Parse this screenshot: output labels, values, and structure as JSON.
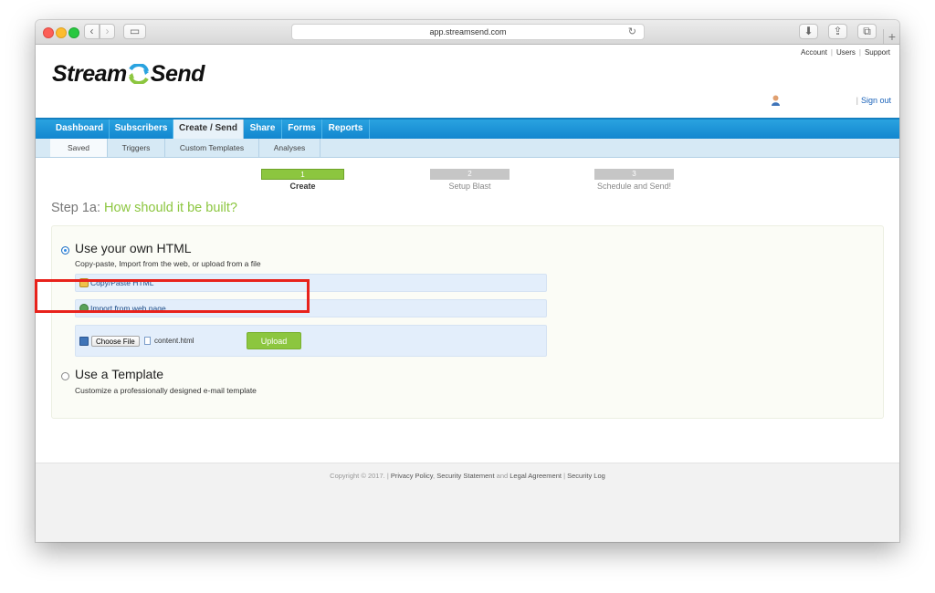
{
  "browser": {
    "url": "app.streamsend.com",
    "back_glyph": "‹",
    "forward_glyph": "›",
    "sidebar_glyph": "▭",
    "reload_glyph": "↻",
    "download_glyph": "⬇",
    "share_glyph": "⇪",
    "tabs_glyph": "⧉",
    "new_tab_glyph": "+"
  },
  "header": {
    "logo_left": "Stream",
    "logo_right": "Send",
    "top_links": [
      "Account",
      "Users",
      "Support"
    ],
    "signout_separator": "|",
    "signout": "Sign out"
  },
  "main_nav": {
    "items": [
      "Dashboard",
      "Subscribers",
      "Create / Send",
      "Share",
      "Forms",
      "Reports"
    ],
    "active": "Create / Send"
  },
  "sub_nav": {
    "items": [
      "Saved",
      "Triggers",
      "Custom Templates",
      "Analyses"
    ],
    "active": "Saved"
  },
  "steps": [
    {
      "number": "1",
      "label": "Create",
      "active": true
    },
    {
      "number": "2",
      "label": "Setup Blast",
      "active": false
    },
    {
      "number": "3",
      "label": "Schedule and Send!",
      "active": false
    }
  ],
  "heading": {
    "prefix": "Step 1a:",
    "question": "How should it be built?"
  },
  "option_html": {
    "title": "Use your own HTML",
    "description": "Copy-paste, Import from the web, or upload from a file",
    "selected": true,
    "copy_paste": "Copy/Paste HTML",
    "import_web": "Import from web page",
    "choose_file": "Choose File",
    "file_name": "content.html",
    "upload": "Upload"
  },
  "option_template": {
    "title": "Use a Template",
    "description": "Customize a professionally designed e-mail template",
    "selected": false
  },
  "footer": {
    "copyright": "Copyright © 2017.",
    "sep1": "|",
    "privacy": "Privacy Policy",
    "comma": ",",
    "security_statement": "Security Statement",
    "and": "and",
    "legal": "Legal Agreement",
    "sep2": "|",
    "security_log": "Security Log"
  },
  "colors": {
    "nav_blue": "#1286cf",
    "accent_green": "#8cc63f",
    "highlight_red": "#e8221b",
    "link_blue": "#1a62b9"
  }
}
